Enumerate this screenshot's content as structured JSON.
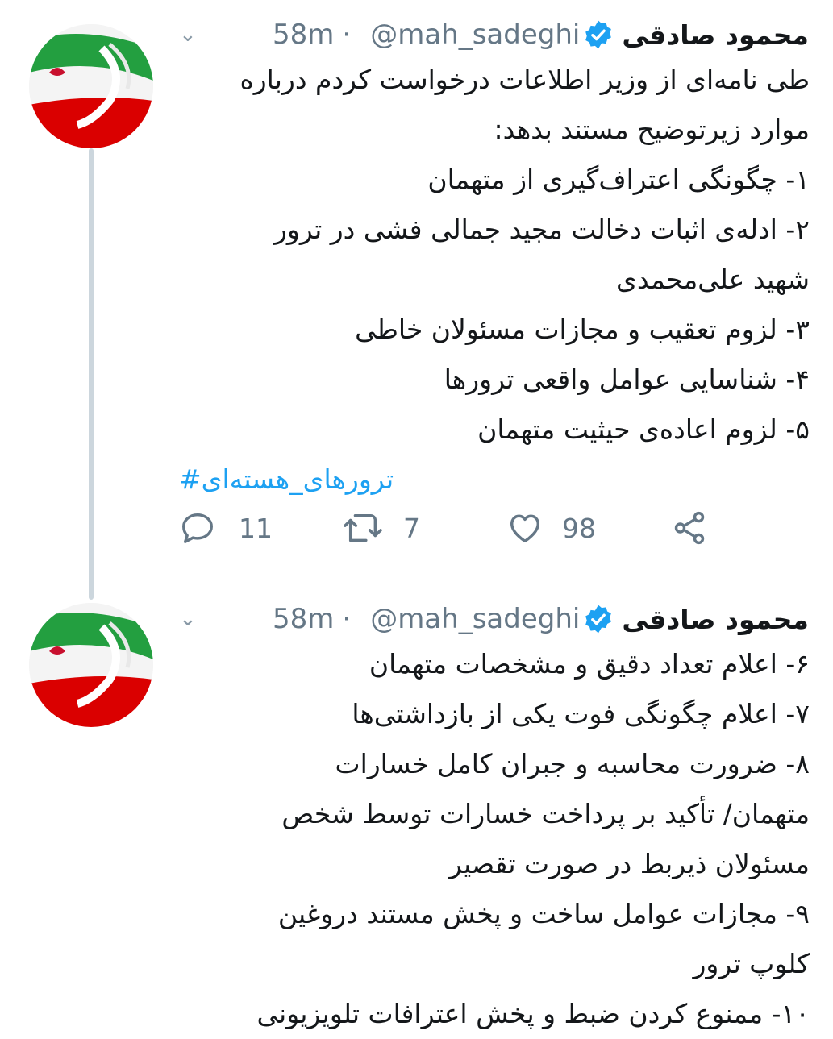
{
  "tweets": [
    {
      "name": "محمود صادقی",
      "handle": "@mah_sadeghi",
      "dot": "·",
      "time": "58m",
      "lines": [
        "طی نامه‌ای از وزیر اطلاعات درخواست کردم درباره",
        "موارد زیرتوضیح مستند بدهد:",
        "۱- چگونگی اعتراف‌گیری از متهمان",
        "۲- ادله‌ی اثبات دخالت مجید جمالی فشی در ترور",
        "شهید علی‌محمدی",
        "۳- لزوم تعقیب و مجازات مسئولان خاطی",
        "۴- شناسایی عوامل واقعی ترورها",
        "۵- لزوم اعاده‌ی حیثیت متهمان"
      ],
      "hashtag": "#ترورهای_هسته‌ای",
      "reply_count": "11",
      "retweet_count": "7",
      "like_count": "98"
    },
    {
      "name": "محمود صادقی",
      "handle": "@mah_sadeghi",
      "dot": "·",
      "time": "58m",
      "lines": [
        "۶- اعلام تعداد دقیق و مشخصات متهمان",
        "۷-  اعلام چگونگی فوت یکی از بازداشتی‌ها",
        "۸- ضرورت محاسبه و جبران کامل خسارات",
        "متهمان/ تأکید بر پرداخت خسارات توسط شخص",
        "مسئولان ذیربط در صورت تقصیر",
        "۹- مجازات عوامل ساخت و پخش مستند دروغین",
        "کلوپ ترور",
        "۱۰- ممنوع کردن ضبط و پخش اعترافات تلویزیونی"
      ]
    }
  ],
  "icons": {
    "more": "chevron-down-icon",
    "verified": "verified-badge-icon",
    "reply": "reply-icon",
    "retweet": "retweet-icon",
    "like": "heart-icon",
    "share": "share-icon"
  },
  "colors": {
    "verified": "#1da1f2",
    "hashtag": "#1da1f2",
    "muted": "#657786",
    "thread_line": "#ccd6dd"
  }
}
